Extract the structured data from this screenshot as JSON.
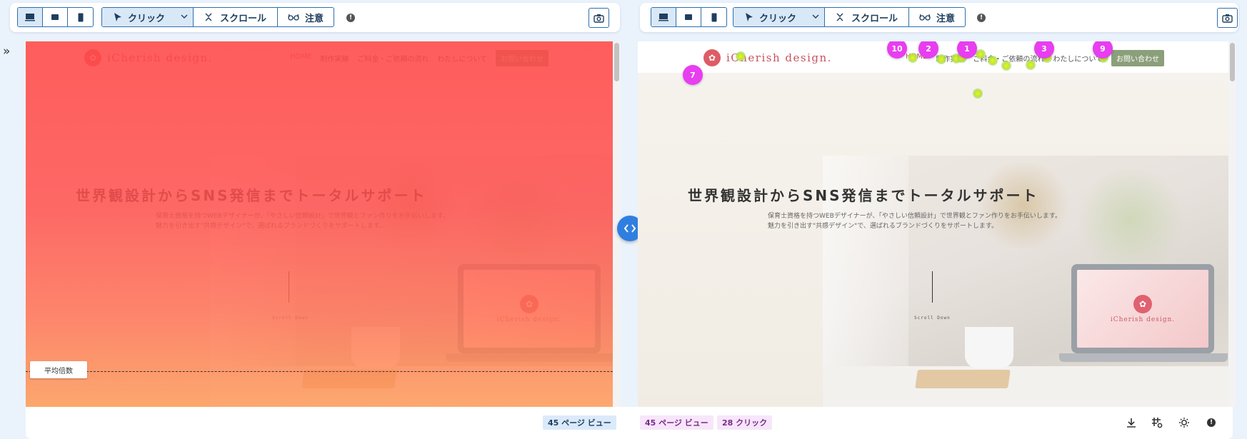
{
  "toolbar": {
    "click_label": "クリック",
    "scroll_label": "スクロール",
    "attention_label": "注意",
    "info": "!"
  },
  "site": {
    "brand": "iCherish design.",
    "brand_mark": "✿",
    "menu": [
      "HOME",
      "制作実績",
      "ご料金・ご依頼の流れ",
      "わたしについて",
      "お問い合わせ"
    ],
    "headline": "世界観設計からSNS発信までトータルサポート",
    "sub_line1": "保育士資格を持つWEBデザイナーが、「やさしい信頼設計」で世界観とファン作りをお手伝いします。",
    "sub_line2": "魅力を引き出す\"共感デザイン\"で、選ばれるブランドづくりをサポートします。",
    "scroll_down": "Scroll Down",
    "laptop_brand": "iCherish design."
  },
  "left_panel": {
    "avg_fold_label": "平均倍数"
  },
  "right_panel": {
    "click_pins": [
      "10",
      "2",
      "1",
      "3",
      "9",
      "7"
    ]
  },
  "footer": {
    "left_pageviews": "45 ページ ビュー",
    "right_pageviews": "45 ページ ビュー",
    "right_clicks": "28 クリック"
  },
  "colors": {
    "accent": "#2e6fae",
    "pin": "#e83df0",
    "brand": "#c7525d",
    "cta": "#8a9f7a"
  }
}
